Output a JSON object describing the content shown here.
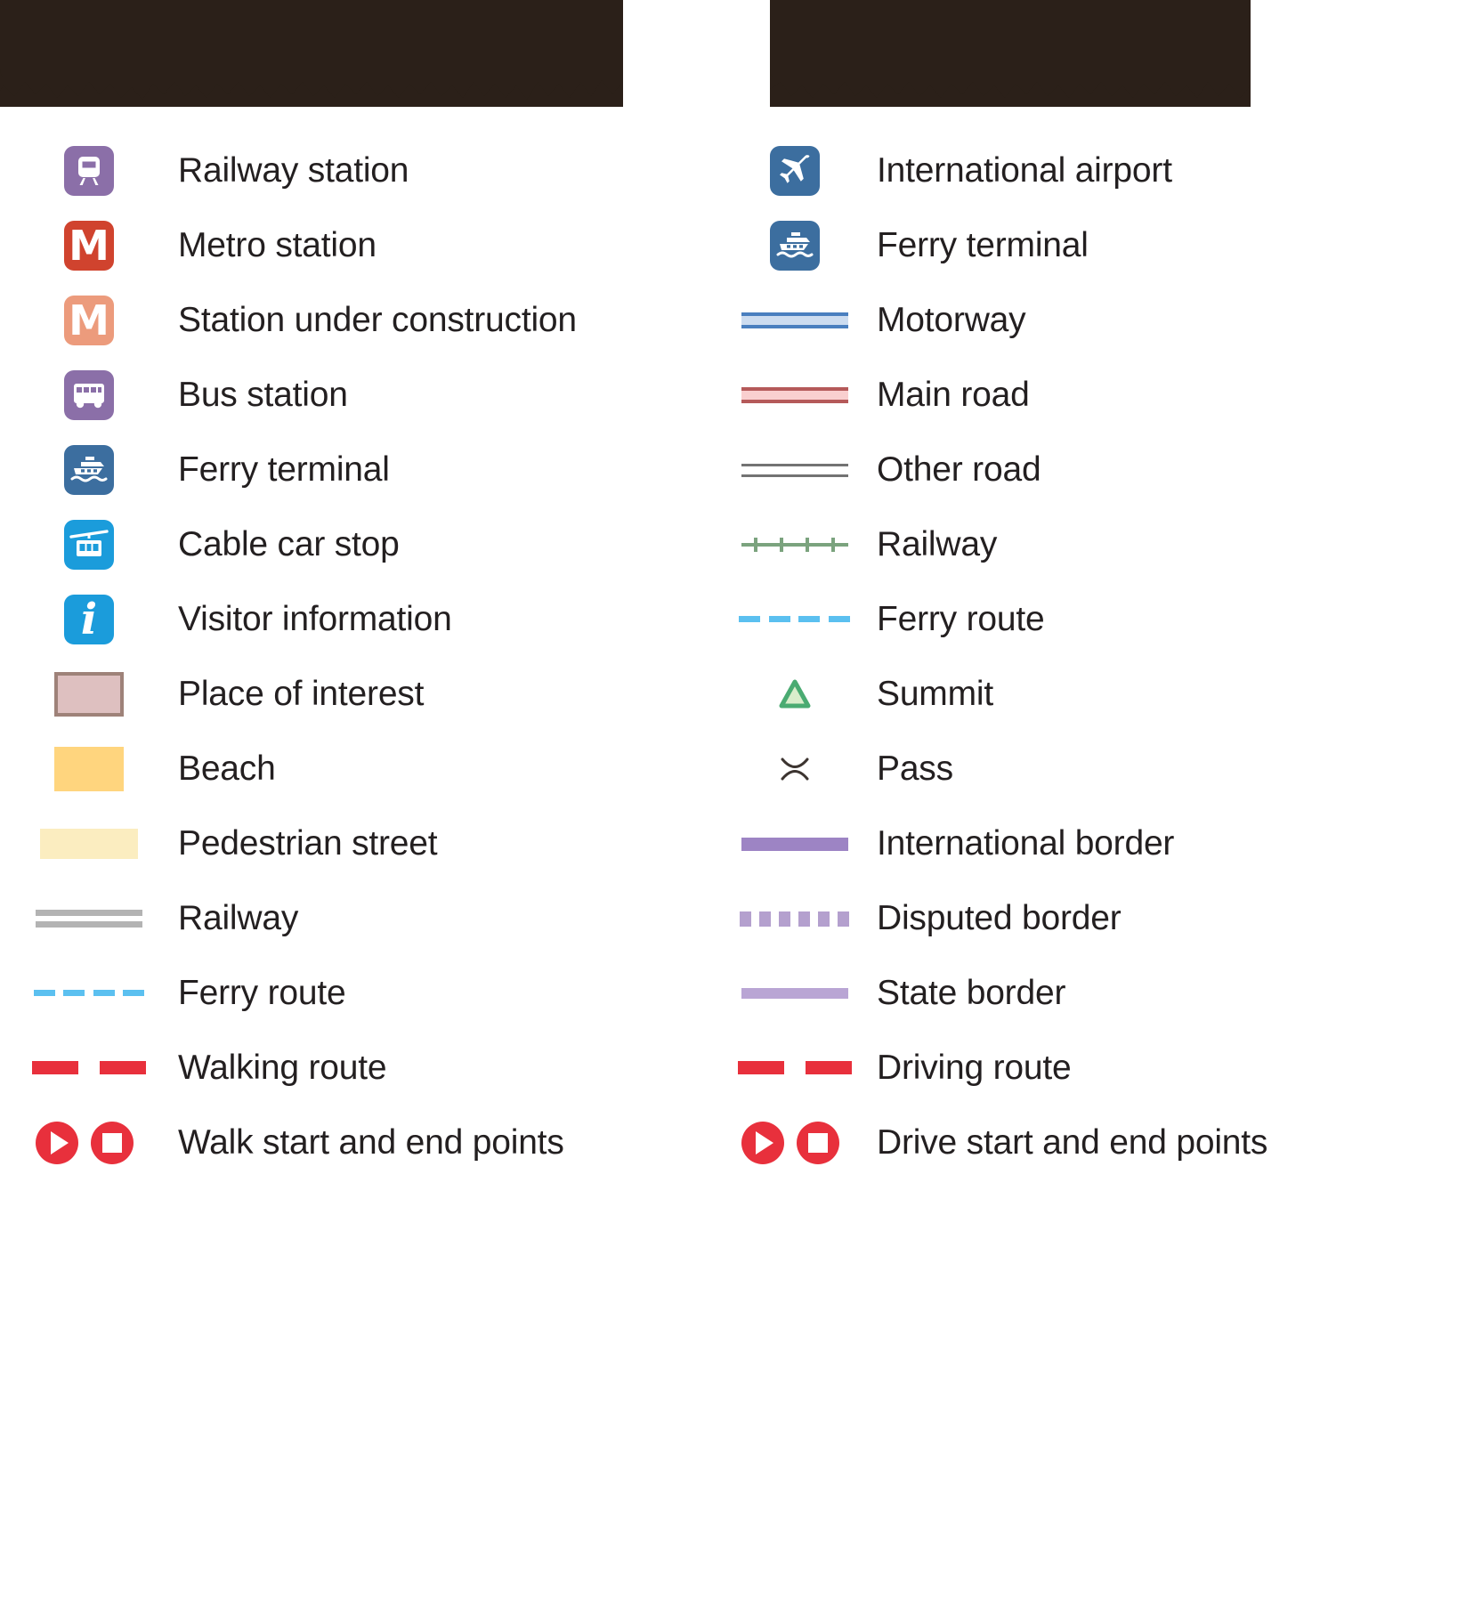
{
  "legend": {
    "left_column": [
      {
        "label": "Railway station",
        "symbol": "railway-station-icon",
        "color": "#8b6fa8"
      },
      {
        "label": "Metro station",
        "symbol": "metro-station-icon",
        "color": "#d0432e",
        "letter": "M"
      },
      {
        "label": "Station under construction",
        "symbol": "metro-construction-icon",
        "color": "#ec9b7c",
        "letter": "M"
      },
      {
        "label": "Bus station",
        "symbol": "bus-station-icon",
        "color": "#8b6fa8"
      },
      {
        "label": "Ferry terminal",
        "symbol": "ferry-terminal-icon",
        "color": "#3c6e9f"
      },
      {
        "label": "Cable car stop",
        "symbol": "cable-car-icon",
        "color": "#1b9cdb"
      },
      {
        "label": "Visitor information",
        "symbol": "visitor-information-icon",
        "color": "#1b9cdb",
        "letter": "i"
      },
      {
        "label": "Place of interest",
        "symbol": "place-of-interest-swatch",
        "color": "#dec0c0",
        "border_color": "#9e8279"
      },
      {
        "label": "Beach",
        "symbol": "beach-swatch",
        "color": "#ffd57e"
      },
      {
        "label": "Pedestrian street",
        "symbol": "pedestrian-street-swatch",
        "color": "#fbedc0"
      },
      {
        "label": "Railway",
        "symbol": "railway-line",
        "color": "#b3b3b3"
      },
      {
        "label": "Ferry route",
        "symbol": "ferry-route-line",
        "color": "#5bc0f0"
      },
      {
        "label": "Walking route",
        "symbol": "walking-route-line",
        "color": "#e8303c"
      },
      {
        "label": "Walk start and end points",
        "symbol": "walk-start-end-points",
        "color": "#e8303c"
      }
    ],
    "right_column": [
      {
        "label": "International airport",
        "symbol": "airport-icon",
        "color": "#3c6e9f"
      },
      {
        "label": "Ferry terminal",
        "symbol": "ferry-terminal-icon",
        "color": "#3c6e9f"
      },
      {
        "label": "Motorway",
        "symbol": "motorway-line",
        "color": "#ccdcf0",
        "border_color": "#4a7fbf"
      },
      {
        "label": "Main road",
        "symbol": "main-road-line",
        "color": "#f9cfcf",
        "border_color": "#b55a5a"
      },
      {
        "label": "Other road",
        "symbol": "other-road-line",
        "color": "#737373"
      },
      {
        "label": "Railway",
        "symbol": "railway-tick-line",
        "color": "#7ba37e"
      },
      {
        "label": "Ferry route",
        "symbol": "ferry-route-line",
        "color": "#5bc0f0"
      },
      {
        "label": "Summit",
        "symbol": "summit-triangle-icon",
        "color": "#4aab72"
      },
      {
        "label": "Pass",
        "symbol": "pass-icon",
        "color": "#3c3430"
      },
      {
        "label": "International border",
        "symbol": "international-border-line",
        "color": "#9d84c4"
      },
      {
        "label": "Disputed border",
        "symbol": "disputed-border-line",
        "color": "#b4a0ce"
      },
      {
        "label": "State border",
        "symbol": "state-border-line",
        "color": "#b9a5d4"
      },
      {
        "label": "Driving route",
        "symbol": "driving-route-line",
        "color": "#e8303c"
      },
      {
        "label": "Drive start and end points",
        "symbol": "drive-start-end-points",
        "color": "#e8303c"
      }
    ]
  },
  "decor": {
    "band_color": "#2b2019"
  }
}
